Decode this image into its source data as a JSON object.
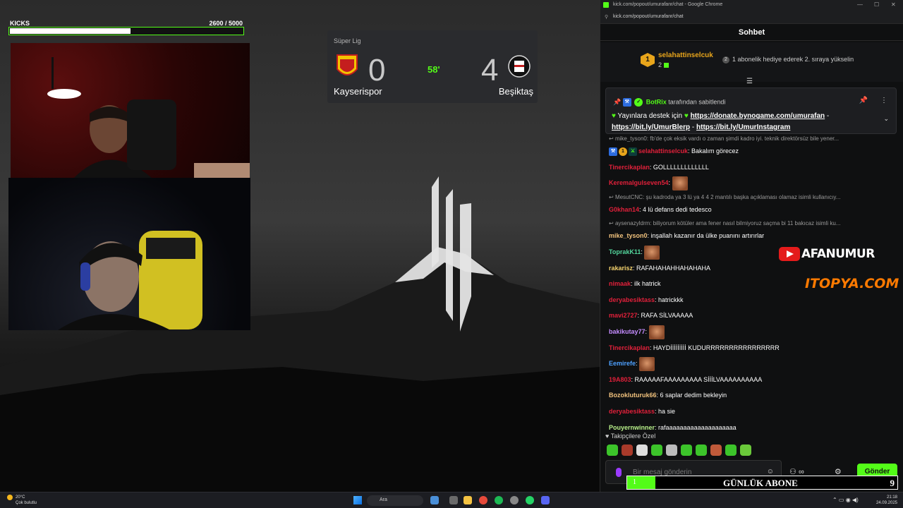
{
  "goal": {
    "title": "KICKS",
    "count": "2600 / 5000",
    "progress": 0.52
  },
  "scoreboard": {
    "league": "Süper Lig",
    "team1": "Kayserispor",
    "team2": "Beşiktaş",
    "score1": "0",
    "score2": "4",
    "minute": "58'"
  },
  "chrome": {
    "title": "kick.com/popout/umurafanr/chat - Google Chrome",
    "url": "kick.com/popout/umurafanr/chat",
    "controls": [
      "—",
      "☐",
      "✕"
    ]
  },
  "chat": {
    "header": "Sohbet",
    "gifter": {
      "rank": "1",
      "name": "selahattinselcuk",
      "count": "2",
      "promo": "1 abonelik hediye ederek 2. sıraya yükselin",
      "promo_rank": "2"
    },
    "pinned": {
      "by": "BotRix",
      "by_suffix": "tarafından sabitlendi",
      "text": "Yayınlara destek için",
      "link1": "https://donate.bynogame.com/umurafan",
      "link2": "https://bit.ly/UmurBlerp",
      "link3": "https://bit.ly/UmurInstagram"
    },
    "messages": [
      {
        "reply": "mike_tyson0: fb'de çok eksik vardı o zaman şimdi kadro iyi. teknik direktörsüz bile yener..."
      },
      {
        "user": "selahattinselcuk",
        "color": "#e0203a",
        "text": ": Bakalım görecez",
        "badges": true
      },
      {
        "user": "Tinercikaplan",
        "color": "#e0203a",
        "text": ": GOLLLLLLLLLLLLL"
      },
      {
        "user": "Keremalgulseven54",
        "color": "#e0203a",
        "text": ":",
        "emote": true
      },
      {
        "reply": "MesutCNC: şu kadroda ya 3 lü ya 4 4 2 mantılı başka açıklaması olamaz isimli kullanıcıy..."
      },
      {
        "user": "G0khan14",
        "color": "#e0203a",
        "text": ": 4 lü defans dedi tedesco"
      },
      {
        "reply": "aysenazyldrm: biliyorum kötüler ama fener nasıl bilmiyoruz saçma bi 11 bakıcaz isimli ku..."
      },
      {
        "user": "mike_tyson0",
        "color": "#f1c27d",
        "text": ": inşallah kazanır da ülke puanını artırırlar"
      },
      {
        "user": "ToprakK11",
        "color": "#53d69c",
        "text": ":",
        "emote": true
      },
      {
        "user": "rakarisz",
        "color": "#f5d36e",
        "text": ": RAFAHAHAHHAHAHAHA"
      },
      {
        "user": "nimaak",
        "color": "#e0203a",
        "text": ": ilk hatrick"
      },
      {
        "user": "deryabesiktass",
        "color": "#e0203a",
        "text": ": hatrickkk"
      },
      {
        "user": "mavi2727",
        "color": "#e0203a",
        "text": ": RAFA SİLVAAAAA"
      },
      {
        "user": "bakikutay77",
        "color": "#c58cff",
        "text": ":",
        "emote": true
      },
      {
        "user": "Tinercikaplan",
        "color": "#e0203a",
        "text": ": HAYDİİİİİİİİİ KUDURRRRRRRRRRRRRRRR"
      },
      {
        "user": "Eemirefe",
        "color": "#4ea1ff",
        "text": ":",
        "emote": true
      },
      {
        "user": "19A803",
        "color": "#e0203a",
        "text": ": RAAAAAFAAAAAAAAA SİİİLVAAAAAAAAAA"
      },
      {
        "user": "Bozokluturuk66",
        "color": "#f1c27d",
        "text": ": 6 saplar dedim bekleyin"
      },
      {
        "user": "deryabesiktass",
        "color": "#e0203a",
        "text": ": ha sie"
      },
      {
        "user": "Pouyernwinner",
        "color": "#b8f08a",
        "text": ": rafaaaaaaaaaaaaaaaaaaaa"
      }
    ],
    "followers_label": "Takipçilere Özel",
    "placeholder": "Bir mesaj gönderin",
    "send": "Gönder"
  },
  "overlays": {
    "youtube": "AFANUMUR",
    "sponsor": "ITOPYA.COM",
    "daily_label": "GÜNLÜK ABONE",
    "daily_count": "1",
    "daily_goal": "9"
  },
  "taskbar": {
    "temp": "20°C",
    "weather": "Çok bulutlu",
    "search": "Ara",
    "time": "21:18",
    "date": "24.09.2025"
  }
}
